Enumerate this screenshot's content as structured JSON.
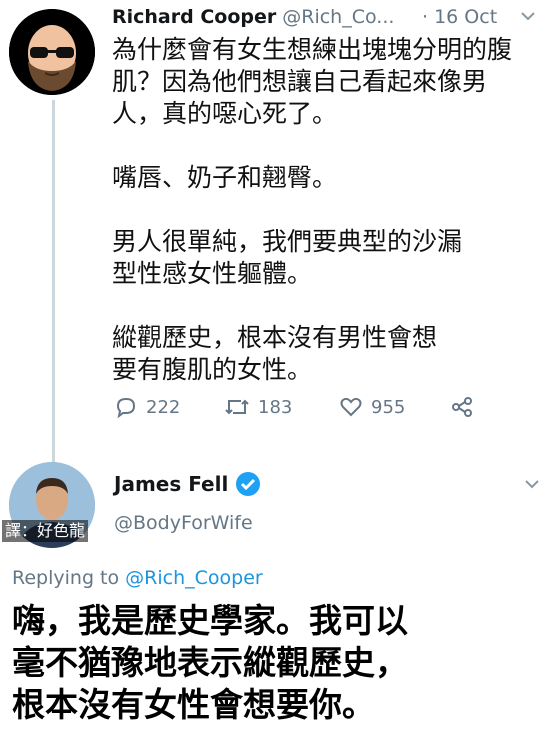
{
  "tweet1": {
    "author_name": "Richard Cooper",
    "handle": "@Rich_Co...",
    "date": "· 16 Oct",
    "paragraphs": [
      "為什麼會有女生想練出塊塊分明的腹肌？因為他們想讓自己看起來像男人，真的噁心死了。",
      "嘴唇、奶子和翹臀。",
      "男人很單純，我們要典型的沙漏型性感女性軀體。",
      "縱觀歷史，根本沒有男性會想要有腹肌的女性。"
    ],
    "reply_count": "222",
    "retweet_count": "183",
    "like_count": "955",
    "icons": [
      "reply-icon",
      "retweet-icon",
      "like-icon",
      "share-icon",
      "chevron-down-icon"
    ]
  },
  "tweet2": {
    "author_name": "James Fell",
    "handle": "@BodyForWife",
    "watermark": "譯：好色龍",
    "replying_prefix": "Replying to ",
    "replying_to": "@Rich_Cooper",
    "body_lines": [
      "嗨，我是歷史學家。我可以",
      "毫不猶豫地表示縱觀歷史，",
      "根本沒有女性會想要你。"
    ],
    "icons": [
      "verified-icon",
      "chevron-down-icon"
    ]
  },
  "colors": {
    "link": "#1b95e0",
    "verified": "#1da1f2",
    "muted": "#657786",
    "thread_line": "#ccd6dd"
  }
}
